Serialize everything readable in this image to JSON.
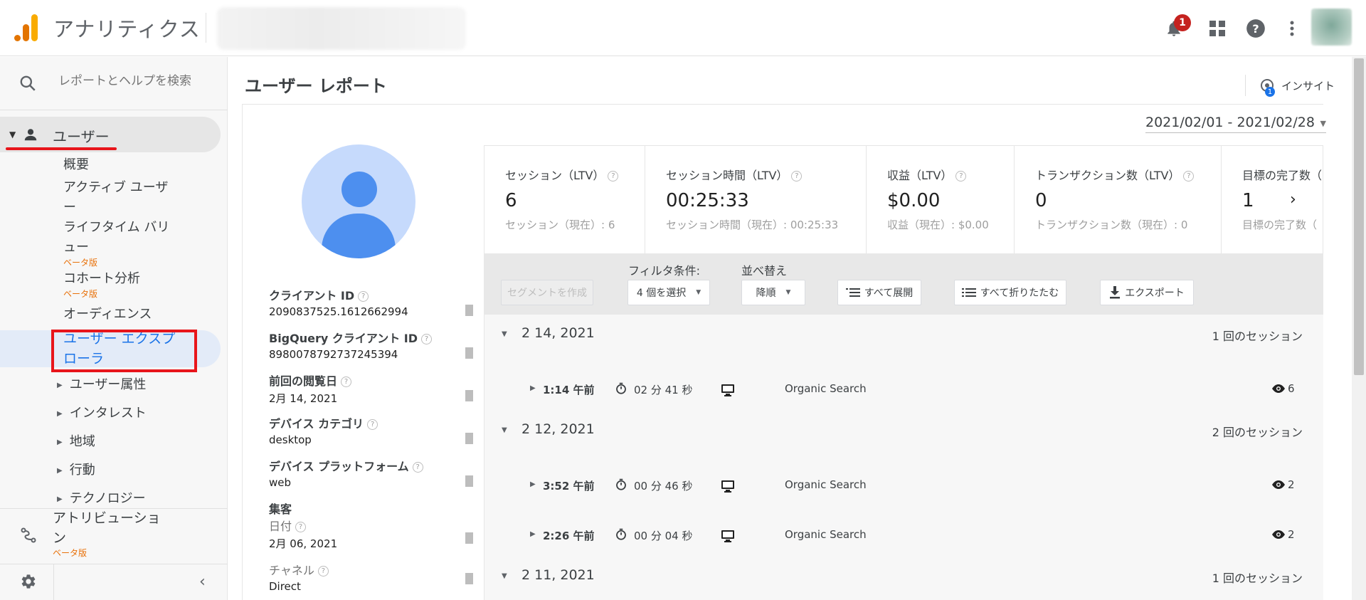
{
  "header": {
    "app_title": "アナリティクス",
    "notification_count": "1",
    "icons": [
      "bell-icon",
      "apps-grid-icon",
      "help-icon",
      "more-vert-icon"
    ]
  },
  "sidebar": {
    "search_placeholder": "レポートとヘルプを検索",
    "users_label": "ユーザー",
    "items": [
      {
        "label": "概要"
      },
      {
        "label": "アクティブ ユーザ ー"
      },
      {
        "label": "ライフタイム バリ ュー",
        "badge": "ベータ版"
      },
      {
        "label": "コホート分析",
        "badge": "ベータ版"
      },
      {
        "label": "オーディエンス"
      },
      {
        "label": "ユーザー エクスプ ローラ"
      }
    ],
    "groups": [
      "ユーザー属性",
      "インタレスト",
      "地域",
      "行動",
      "テクノロジー"
    ],
    "attribution_label": "アトリビューショ ン",
    "attribution_badge": "ベータ版"
  },
  "main": {
    "title": "ユーザー レポート",
    "insight_label": "インサイト",
    "insight_count": "1",
    "date_range": "2021/02/01 - 2021/02/28"
  },
  "profile": {
    "properties": [
      {
        "key": "クライアント ID",
        "value": "2090837525.1612662994",
        "help": true
      },
      {
        "key": "BigQuery クライアント ID",
        "value": "8980078792737245394",
        "help": true
      },
      {
        "key": "前回の閲覧日",
        "value": "2月 14, 2021",
        "help": true
      },
      {
        "key": "デバイス カテゴリ",
        "value": "desktop",
        "help": true
      },
      {
        "key": "デバイス プラットフォーム",
        "value": "web",
        "help": true
      }
    ],
    "acquisition": {
      "heading": "集客",
      "date_label": "日付",
      "date_value": "2月 06, 2021",
      "channel_label": "チャネル",
      "channel_value": "Direct"
    }
  },
  "metrics": [
    {
      "title": "セッション（LTV）",
      "value": "6",
      "sub": "セッション（現在）: 6"
    },
    {
      "title": "セッション時間（LTV）",
      "value": "00:25:33",
      "sub": "セッション時間（現在）: 00:25:33"
    },
    {
      "title": "収益（LTV）",
      "value": "$0.00",
      "sub": "収益（現在）: $0.00"
    },
    {
      "title": "トランザクション数（LTV）",
      "value": "0",
      "sub": "トランザクション数（現在）: 0"
    },
    {
      "title": "目標の完了数（",
      "value": "1",
      "sub": "目標の完了数（"
    }
  ],
  "toolbar": {
    "segment_button": "セグメントを作成",
    "filter_label": "フィルタ条件:",
    "filter_value": "4 個を選択",
    "sort_label": "並べ替え",
    "sort_value": "降順",
    "expand_all": "すべて展開",
    "collapse_all": "すべて折りたたむ",
    "export": "エクスポート"
  },
  "sessions": {
    "days": [
      {
        "date": "2 14, 2021",
        "count": "1 回のセッション",
        "rows": [
          {
            "time": "1:14 午前",
            "duration": "02 分 41 秒",
            "source": "Organic Search",
            "pageviews": "6"
          }
        ]
      },
      {
        "date": "2 12, 2021",
        "count": "2 回のセッション",
        "rows": [
          {
            "time": "3:52 午前",
            "duration": "00 分 46 秒",
            "source": "Organic Search",
            "pageviews": "2"
          },
          {
            "time": "2:26 午前",
            "duration": "00 分 04 秒",
            "source": "Organic Search",
            "pageviews": "2"
          }
        ]
      },
      {
        "date": "2 11, 2021",
        "count": "1 回のセッション",
        "rows": []
      }
    ]
  },
  "colors": {
    "accent": "#1a73e8",
    "highlight": "#e8151b",
    "beta": "#e8710a",
    "logo_orange": "#f9ab00",
    "logo_dark": "#e37400"
  }
}
